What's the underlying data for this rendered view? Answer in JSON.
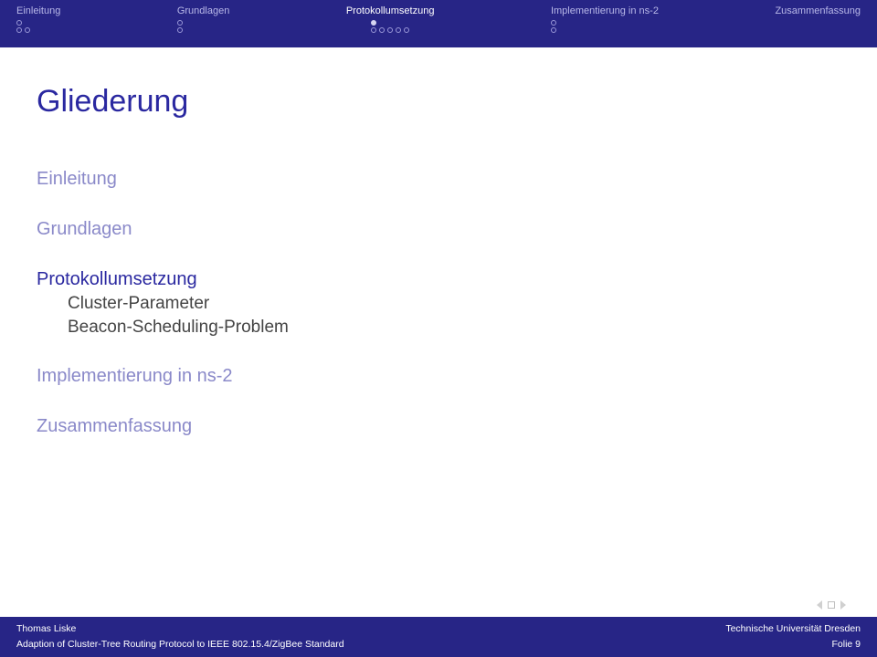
{
  "nav": {
    "items": [
      {
        "label": "Einleitung"
      },
      {
        "label": "Grundlagen"
      },
      {
        "label": "Protokollumsetzung"
      },
      {
        "label": "Implementierung in ns-2"
      },
      {
        "label": "Zusammenfassung"
      }
    ]
  },
  "title": "Gliederung",
  "toc": {
    "s1": "Einleitung",
    "s2": "Grundlagen",
    "s3": "Protokollumsetzung",
    "s3a": "Cluster-Parameter",
    "s3b": "Beacon-Scheduling-Problem",
    "s4": "Implementierung in ns-2",
    "s5": "Zusammenfassung"
  },
  "footer": {
    "author": "Thomas Liske",
    "affiliation": "Technische Universität Dresden",
    "talk": "Adaption of Cluster-Tree Routing Protocol to IEEE 802.15.4/ZigBee Standard",
    "page": "Folie 9"
  }
}
